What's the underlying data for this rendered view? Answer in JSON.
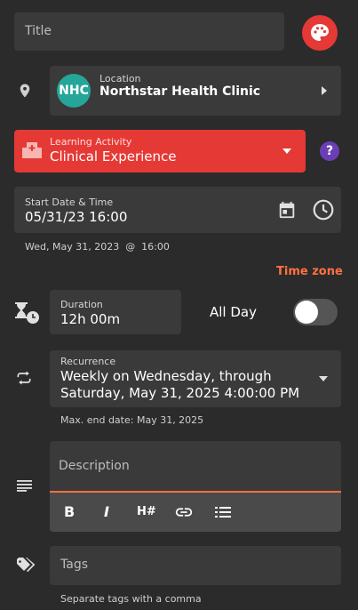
{
  "title": {
    "placeholder": "Title"
  },
  "location": {
    "avatar_text": "NHC",
    "label": "Location",
    "value": "Northstar Health Clinic",
    "avatar_color": "#26a69a"
  },
  "activity": {
    "label": "Learning Activity",
    "value": "Clinical Experience",
    "bg_color": "#e53935"
  },
  "help": {
    "symbol": "?",
    "color": "#6a3fb5"
  },
  "start": {
    "label": "Start Date & Time",
    "value": "05/31/23 16:00",
    "preview": "Wed, May 31, 2023  @  16:00"
  },
  "timezone_link": "Time zone",
  "duration": {
    "label": "Duration",
    "value": "12h 00m"
  },
  "all_day": {
    "label": "All Day",
    "checked": false
  },
  "recurrence": {
    "label": "Recurrence",
    "line1": "Weekly on Wednesday, through",
    "line2": "Saturday, May 31, 2025 4:00:00 PM",
    "max_end": "Max. end date: May 31, 2025"
  },
  "description": {
    "placeholder": "Description",
    "toolbar": {
      "bold": "B",
      "italic": "I",
      "heading": "H#"
    }
  },
  "tags": {
    "placeholder": "Tags",
    "hint": "Separate tags with a comma"
  },
  "colors": {
    "accent_orange": "#ff7043",
    "palette_button": "#e53935"
  }
}
